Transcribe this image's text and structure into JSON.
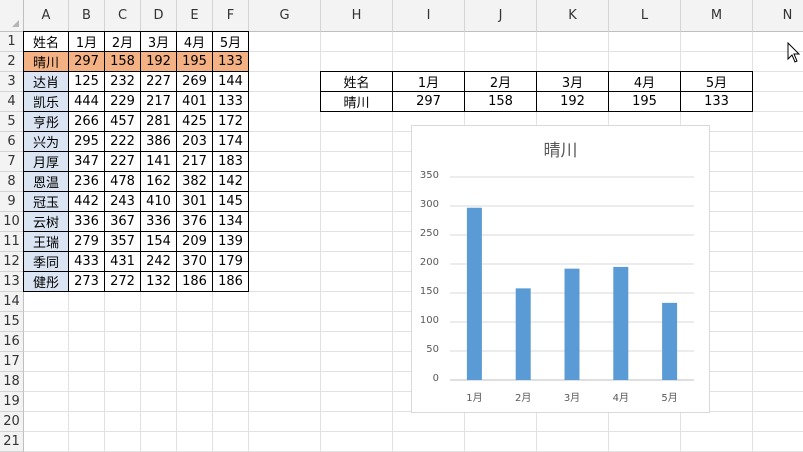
{
  "sheet": {
    "columns": [
      "A",
      "B",
      "C",
      "D",
      "E",
      "F",
      "G",
      "H",
      "I",
      "J",
      "K",
      "L",
      "M",
      "N"
    ],
    "row_numbers": [
      "1",
      "2",
      "3",
      "4",
      "5",
      "6",
      "7",
      "8",
      "9",
      "10",
      "11",
      "12",
      "13",
      "14",
      "15",
      "16",
      "17",
      "18",
      "19",
      "20",
      "21"
    ],
    "header": [
      "姓名",
      "1月",
      "2月",
      "3月",
      "4月",
      "5月"
    ],
    "rows": [
      [
        "晴川",
        "297",
        "158",
        "192",
        "195",
        "133"
      ],
      [
        "达肖",
        "125",
        "232",
        "227",
        "269",
        "144"
      ],
      [
        "凯乐",
        "444",
        "229",
        "217",
        "401",
        "133"
      ],
      [
        "亨彤",
        "266",
        "457",
        "281",
        "425",
        "172"
      ],
      [
        "兴为",
        "295",
        "222",
        "386",
        "203",
        "174"
      ],
      [
        "月厚",
        "347",
        "227",
        "141",
        "217",
        "183"
      ],
      [
        "恩温",
        "236",
        "478",
        "162",
        "382",
        "142"
      ],
      [
        "冠玉",
        "442",
        "243",
        "410",
        "301",
        "145"
      ],
      [
        "云树",
        "336",
        "367",
        "336",
        "376",
        "134"
      ],
      [
        "王瑞",
        "279",
        "357",
        "154",
        "209",
        "139"
      ],
      [
        "季同",
        "433",
        "431",
        "242",
        "370",
        "179"
      ],
      [
        "健彤",
        "273",
        "272",
        "132",
        "186",
        "186"
      ]
    ]
  },
  "lookup": {
    "header": [
      "姓名",
      "1月",
      "2月",
      "3月",
      "4月",
      "5月"
    ],
    "row": [
      "晴川",
      "297",
      "158",
      "192",
      "195",
      "133"
    ]
  },
  "colors": {
    "highlight": "#f4b183",
    "name_fill": "#dbe4f2",
    "bar": "#5b9bd5"
  },
  "chart_data": {
    "type": "bar",
    "title": "晴川",
    "categories": [
      "1月",
      "2月",
      "3月",
      "4月",
      "5月"
    ],
    "values": [
      297,
      158,
      192,
      195,
      133
    ],
    "ylim": [
      0,
      350
    ],
    "yticks": [
      0,
      50,
      100,
      150,
      200,
      250,
      300,
      350
    ],
    "grid": true
  }
}
